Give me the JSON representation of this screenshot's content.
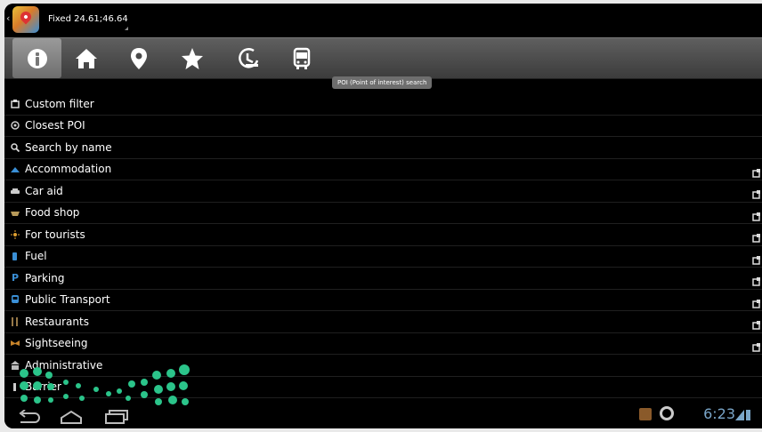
{
  "title_bar": {
    "text": "Fixed 24.61;46.64"
  },
  "toolbar": {
    "buttons": [
      {
        "name": "info",
        "icon": "info-icon"
      },
      {
        "name": "home",
        "icon": "home-icon"
      },
      {
        "name": "location",
        "icon": "location-pin-icon"
      },
      {
        "name": "favorites",
        "icon": "star-icon"
      },
      {
        "name": "history",
        "icon": "history-clock-icon"
      },
      {
        "name": "transport",
        "icon": "bus-icon"
      }
    ],
    "tooltip": "POI (Point of interest) search"
  },
  "poi_list": [
    {
      "label": "Custom filter",
      "icon": "filter-icon",
      "has_action": false
    },
    {
      "label": "Closest POI",
      "icon": "closest-icon",
      "has_action": false
    },
    {
      "label": "Search by name",
      "icon": "search-icon",
      "has_action": false
    },
    {
      "label": "Accommodation",
      "icon": "bed-icon",
      "has_action": true
    },
    {
      "label": "Car aid",
      "icon": "car-icon",
      "has_action": true
    },
    {
      "label": "Food shop",
      "icon": "basket-icon",
      "has_action": true
    },
    {
      "label": "For tourists",
      "icon": "sun-icon",
      "has_action": true
    },
    {
      "label": "Fuel",
      "icon": "fuel-icon",
      "has_action": true
    },
    {
      "label": "Parking",
      "icon": "parking-icon",
      "has_action": true
    },
    {
      "label": "Public Transport",
      "icon": "bus-icon",
      "has_action": true
    },
    {
      "label": "Restaurants",
      "icon": "fork-knife-icon",
      "has_action": true
    },
    {
      "label": "Sightseeing",
      "icon": "camera-icon",
      "has_action": true
    },
    {
      "label": "Administrative",
      "icon": "building-icon",
      "has_action": false
    },
    {
      "label": "Barrier",
      "icon": "barrier-icon",
      "has_action": false
    }
  ],
  "status": {
    "clock": "6:23"
  },
  "colors": {
    "accent_blue": "#3a8fd6",
    "logo_green": "#2bc48a",
    "toolbar": "#4a4a4a"
  }
}
